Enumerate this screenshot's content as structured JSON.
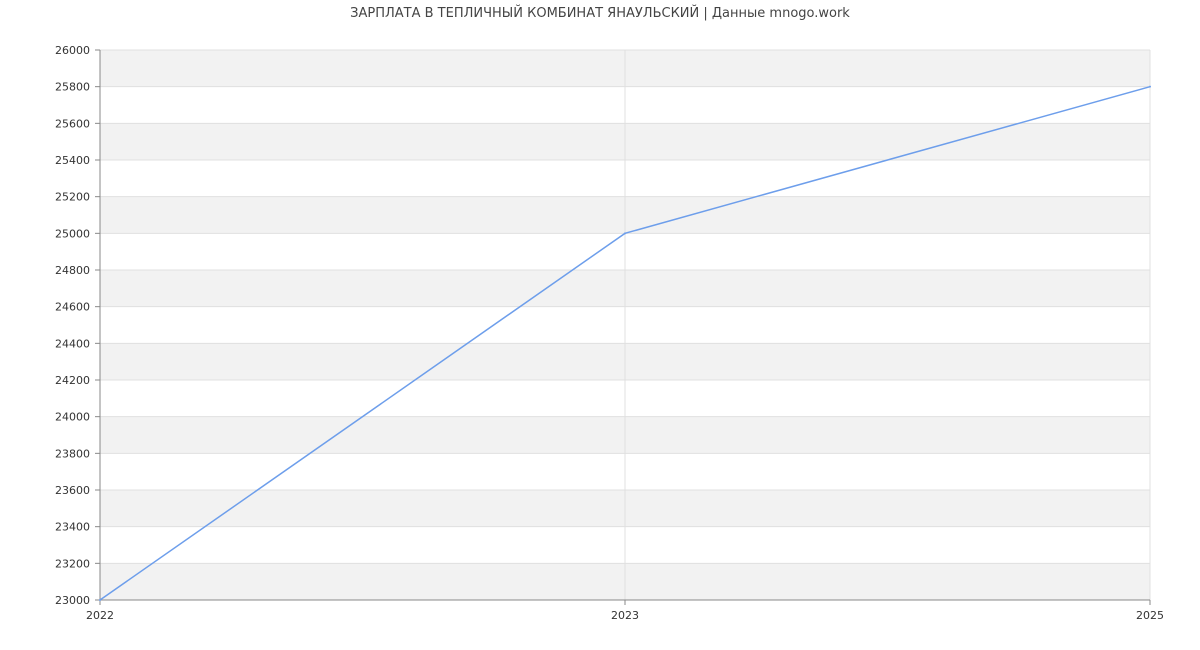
{
  "title": "ЗАРПЛАТА В  ТЕПЛИЧНЫЙ КОМБИНАТ ЯНАУЛЬСКИЙ | Данные mnogo.work",
  "colors": {
    "line": "#6d9eeb",
    "band": "#f2f2f2",
    "grid": "#e0e0e0",
    "axis": "#888888"
  },
  "chart_data": {
    "type": "line",
    "title": "ЗАРПЛАТА В  ТЕПЛИЧНЫЙ КОМБИНАТ ЯНАУЛЬСКИЙ | Данные mnogo.work",
    "xlabel": "",
    "ylabel": "",
    "x_ticks": [
      "2022",
      "2023",
      "2025"
    ],
    "x": [
      "2022",
      "2023",
      "2025"
    ],
    "series": [
      {
        "values": [
          23000,
          25000,
          25800
        ]
      }
    ],
    "y_ticks": [
      23000,
      23200,
      23400,
      23600,
      23800,
      24000,
      24200,
      24400,
      24600,
      24800,
      25000,
      25200,
      25400,
      25600,
      25800,
      26000
    ],
    "ylim": [
      23000,
      26000
    ],
    "grid": true,
    "legend": "none"
  }
}
